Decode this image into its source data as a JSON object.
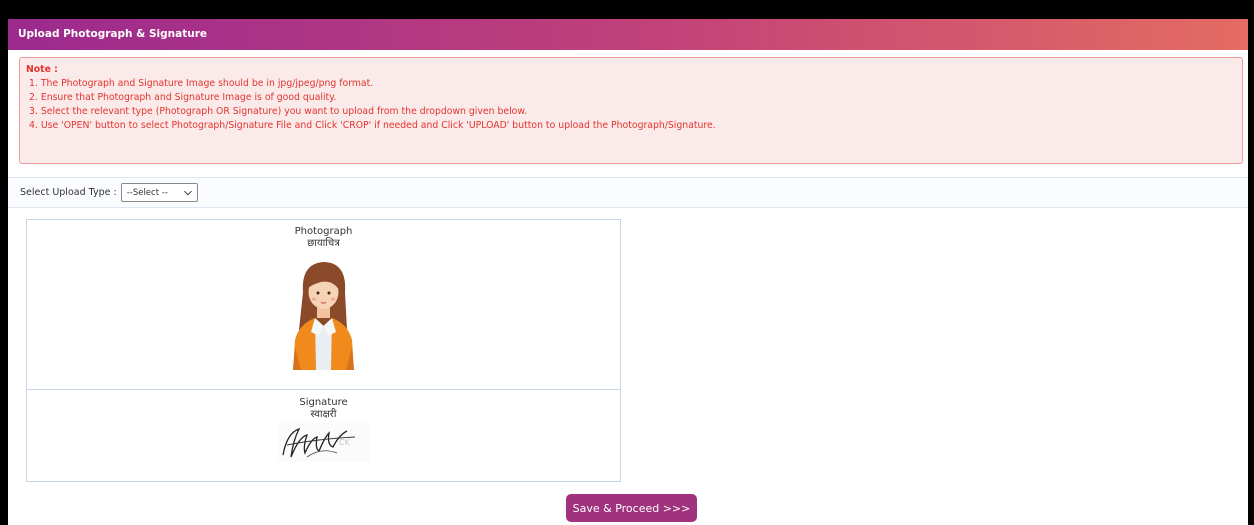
{
  "header": {
    "title": "Upload Photograph & Signature"
  },
  "note": {
    "title": "Note :",
    "items": [
      "1. The Photograph and Signature Image should be in jpg/jpeg/png format.",
      "2. Ensure that Photograph and Signature Image is of good quality.",
      "3. Select the relevant type (Photograph OR Signature) you want to upload from the dropdown given below.",
      "4. Use 'OPEN' button to select Photograph/Signature File and Click 'CROP' if needed and Click 'UPLOAD' button to upload the Photograph/Signature."
    ]
  },
  "upload": {
    "label": "Select Upload Type :",
    "selected": "--Select --"
  },
  "photograph": {
    "label_en": "Photograph",
    "label_hi": "छायाचित्र"
  },
  "signature": {
    "label_en": "Signature",
    "label_hi": "स्वाक्षरी"
  },
  "actions": {
    "save": "Save & Proceed >>>"
  },
  "colors": {
    "header_start": "#9b2a8f",
    "header_end": "#e46c62",
    "note_text": "#e3342f",
    "button": "#a0327e"
  }
}
